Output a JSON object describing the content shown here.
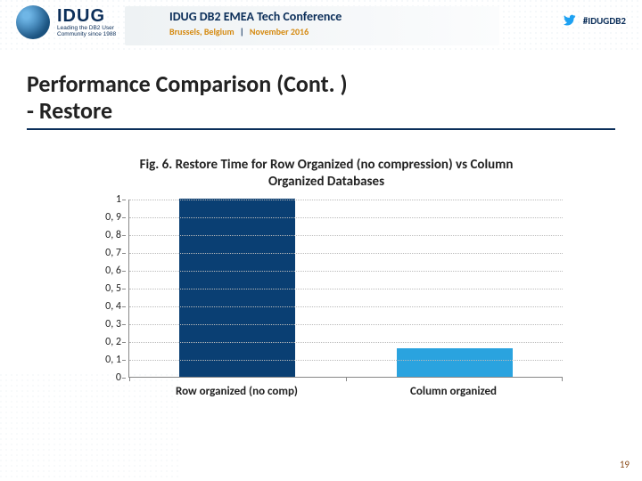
{
  "header": {
    "logo_text": "IDUG",
    "logo_tag1": "Leading the DB2 User",
    "logo_tag2": "Community since 1988",
    "conf_title": "IDUG DB2 EMEA Tech Conference",
    "conf_city": "Brussels, Belgium",
    "conf_sep": "|",
    "conf_date": "November 2016",
    "hashtag": "#IDUGDB2"
  },
  "title": {
    "line1": "Performance Comparison (Cont. )",
    "line2": "- Restore"
  },
  "chart_data": {
    "type": "bar",
    "title": "Fig. 6. Restore Time for Row Organized (no compression) vs Column Organized Databases",
    "categories": [
      "Row organized  (no comp)",
      "Column organized"
    ],
    "values": [
      1.0,
      0.16
    ],
    "ylim": [
      0,
      1
    ],
    "yticks": [
      "0",
      "0, 1",
      "0, 2",
      "0, 3",
      "0, 4",
      "0, 5",
      "0, 6",
      "0, 7",
      "0, 8",
      "0, 9",
      "1"
    ],
    "colors": [
      "#0a3f73",
      "#2aa3df"
    ]
  },
  "page_number": "19"
}
